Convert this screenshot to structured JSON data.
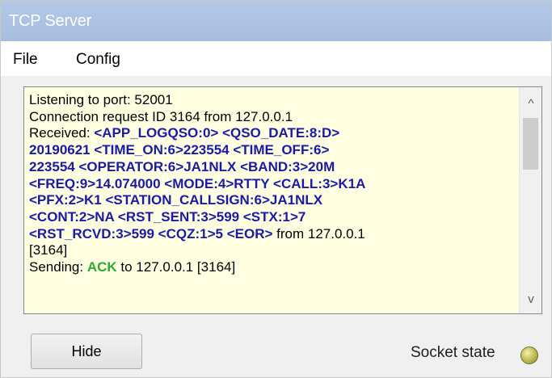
{
  "window": {
    "title": "TCP Server"
  },
  "menu": {
    "items": [
      "File",
      "Config"
    ]
  },
  "log": {
    "lines": [
      [
        {
          "text": "Listening to port: 52001",
          "style": "plain"
        }
      ],
      [
        {
          "text": "Connection request ID 3164 from 127.0.0.1",
          "style": "plain"
        }
      ],
      [
        {
          "text": "Received: ",
          "style": "plain"
        },
        {
          "text": "<APP_LOGQSO:0> <QSO_DATE:8:D>",
          "style": "msg"
        }
      ],
      [
        {
          "text": "20190621 <TIME_ON:6>223554 <TIME_OFF:6>",
          "style": "msg"
        }
      ],
      [
        {
          "text": "223554 <OPERATOR:6>JA1NLX <BAND:3>20M",
          "style": "msg"
        }
      ],
      [
        {
          "text": "<FREQ:9>14.074000 <MODE:4>RTTY <CALL:3>K1A",
          "style": "msg"
        }
      ],
      [
        {
          "text": "<PFX:2>K1 <STATION_CALLSIGN:6>JA1NLX",
          "style": "msg"
        }
      ],
      [
        {
          "text": "<CONT:2>NA <RST_SENT:3>599 <STX:1>7",
          "style": "msg"
        }
      ],
      [
        {
          "text": "<RST_RCVD:3>599 <CQZ:1>5 <EOR>",
          "style": "msg"
        },
        {
          "text": " from 127.0.0.1",
          "style": "plain"
        }
      ],
      [
        {
          "text": "[3164]",
          "style": "plain"
        }
      ],
      [
        {
          "text": "Sending: ",
          "style": "plain"
        },
        {
          "text": "ACK",
          "style": "ack"
        },
        {
          "text": " to 127.0.0.1 [3164]",
          "style": "plain"
        }
      ]
    ],
    "scroll_up_glyph": "^",
    "scroll_down_glyph": "v"
  },
  "footer": {
    "hide_label": "Hide",
    "socket_state_label": "Socket state"
  },
  "colors": {
    "title_bar": "#a7bee0",
    "log_background": "#ffffe1",
    "message_text": "#1a1aa6",
    "ack_text": "#2fa830",
    "socket_indicator": "#c8c25a"
  },
  "icons": {
    "scroll_up": "chevron-up-icon",
    "scroll_down": "chevron-down-icon",
    "socket_indicator": "status-led-icon"
  }
}
